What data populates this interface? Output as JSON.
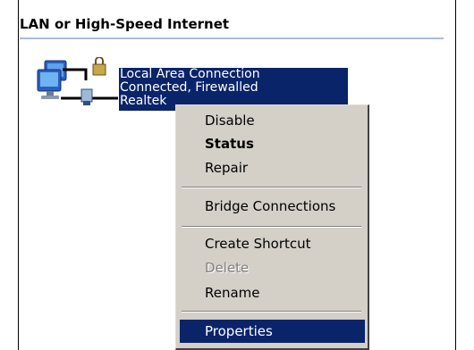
{
  "group": {
    "header": "LAN or High-Speed Internet"
  },
  "connection": {
    "icon": "network-connection-firewalled-icon",
    "name": "Local Area Connection",
    "status": "Connected, Firewalled",
    "adapter": "Realtek"
  },
  "context_menu": {
    "items": [
      {
        "label": "Disable"
      },
      {
        "label": "Status"
      },
      {
        "label": "Repair"
      },
      {
        "label": "Bridge Connections"
      },
      {
        "label": "Create Shortcut"
      },
      {
        "label": "Delete"
      },
      {
        "label": "Rename"
      },
      {
        "label": "Properties"
      }
    ]
  },
  "colors": {
    "selection": "#0a246a",
    "menu_background": "#d4d0c8",
    "header_rule": "#a9bde0",
    "disabled_text": "#808080"
  }
}
